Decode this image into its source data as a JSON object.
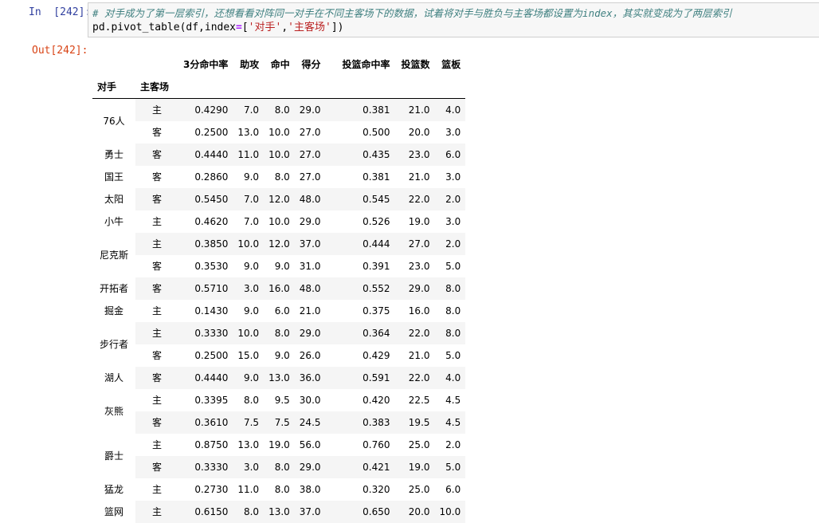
{
  "input_cell": {
    "prompt": "In  [242]:",
    "comment": "# 对手成为了第一层索引，还想看看对阵同一对手在不同主客场下的数据，试着将对手与胜负与主客场都设置为index，其实就变成为了两层索引",
    "code_prefix": "pd.pivot_table(df,index",
    "code_op": "=",
    "code_open": "[",
    "code_str1": "'对手'",
    "code_comma": ",",
    "code_str2": "'主客场'",
    "code_close": "])"
  },
  "output_cell": {
    "prompt": "Out[242]:"
  },
  "table": {
    "columns": [
      "3分命中率",
      "助攻",
      "命中",
      "得分",
      "投篮命中率",
      "投篮数",
      "篮板"
    ],
    "index_names": [
      "对手",
      "主客场"
    ],
    "groups": [
      {
        "team": "76人",
        "rows": [
          {
            "home": "主",
            "values": [
              "0.4290",
              "7.0",
              "8.0",
              "29.0",
              "0.381",
              "21.0",
              "4.0"
            ]
          },
          {
            "home": "客",
            "values": [
              "0.2500",
              "13.0",
              "10.0",
              "27.0",
              "0.500",
              "20.0",
              "3.0"
            ]
          }
        ]
      },
      {
        "team": "勇士",
        "rows": [
          {
            "home": "客",
            "values": [
              "0.4440",
              "11.0",
              "10.0",
              "27.0",
              "0.435",
              "23.0",
              "6.0"
            ]
          }
        ]
      },
      {
        "team": "国王",
        "rows": [
          {
            "home": "客",
            "values": [
              "0.2860",
              "9.0",
              "8.0",
              "27.0",
              "0.381",
              "21.0",
              "3.0"
            ]
          }
        ]
      },
      {
        "team": "太阳",
        "rows": [
          {
            "home": "客",
            "values": [
              "0.5450",
              "7.0",
              "12.0",
              "48.0",
              "0.545",
              "22.0",
              "2.0"
            ]
          }
        ]
      },
      {
        "team": "小牛",
        "rows": [
          {
            "home": "主",
            "values": [
              "0.4620",
              "7.0",
              "10.0",
              "29.0",
              "0.526",
              "19.0",
              "3.0"
            ]
          }
        ]
      },
      {
        "team": "尼克斯",
        "rows": [
          {
            "home": "主",
            "values": [
              "0.3850",
              "10.0",
              "12.0",
              "37.0",
              "0.444",
              "27.0",
              "2.0"
            ]
          },
          {
            "home": "客",
            "values": [
              "0.3530",
              "9.0",
              "9.0",
              "31.0",
              "0.391",
              "23.0",
              "5.0"
            ]
          }
        ]
      },
      {
        "team": "开拓者",
        "rows": [
          {
            "home": "客",
            "values": [
              "0.5710",
              "3.0",
              "16.0",
              "48.0",
              "0.552",
              "29.0",
              "8.0"
            ]
          }
        ]
      },
      {
        "team": "掘金",
        "rows": [
          {
            "home": "主",
            "values": [
              "0.1430",
              "9.0",
              "6.0",
              "21.0",
              "0.375",
              "16.0",
              "8.0"
            ]
          }
        ]
      },
      {
        "team": "步行者",
        "rows": [
          {
            "home": "主",
            "values": [
              "0.3330",
              "10.0",
              "8.0",
              "29.0",
              "0.364",
              "22.0",
              "8.0"
            ]
          },
          {
            "home": "客",
            "values": [
              "0.2500",
              "15.0",
              "9.0",
              "26.0",
              "0.429",
              "21.0",
              "5.0"
            ]
          }
        ]
      },
      {
        "team": "湖人",
        "rows": [
          {
            "home": "客",
            "values": [
              "0.4440",
              "9.0",
              "13.0",
              "36.0",
              "0.591",
              "22.0",
              "4.0"
            ]
          }
        ]
      },
      {
        "team": "灰熊",
        "rows": [
          {
            "home": "主",
            "values": [
              "0.3395",
              "8.0",
              "9.5",
              "30.0",
              "0.420",
              "22.5",
              "4.5"
            ]
          },
          {
            "home": "客",
            "values": [
              "0.3610",
              "7.5",
              "7.5",
              "24.5",
              "0.383",
              "19.5",
              "4.5"
            ]
          }
        ]
      },
      {
        "team": "爵士",
        "rows": [
          {
            "home": "主",
            "values": [
              "0.8750",
              "13.0",
              "19.0",
              "56.0",
              "0.760",
              "25.0",
              "2.0"
            ]
          },
          {
            "home": "客",
            "values": [
              "0.3330",
              "3.0",
              "8.0",
              "29.0",
              "0.421",
              "19.0",
              "5.0"
            ]
          }
        ]
      },
      {
        "team": "猛龙",
        "rows": [
          {
            "home": "主",
            "values": [
              "0.2730",
              "11.0",
              "8.0",
              "38.0",
              "0.320",
              "25.0",
              "6.0"
            ]
          }
        ]
      },
      {
        "team": "篮网",
        "rows": [
          {
            "home": "主",
            "values": [
              "0.6150",
              "8.0",
              "13.0",
              "37.0",
              "0.650",
              "20.0",
              "10.0"
            ]
          }
        ]
      }
    ]
  }
}
